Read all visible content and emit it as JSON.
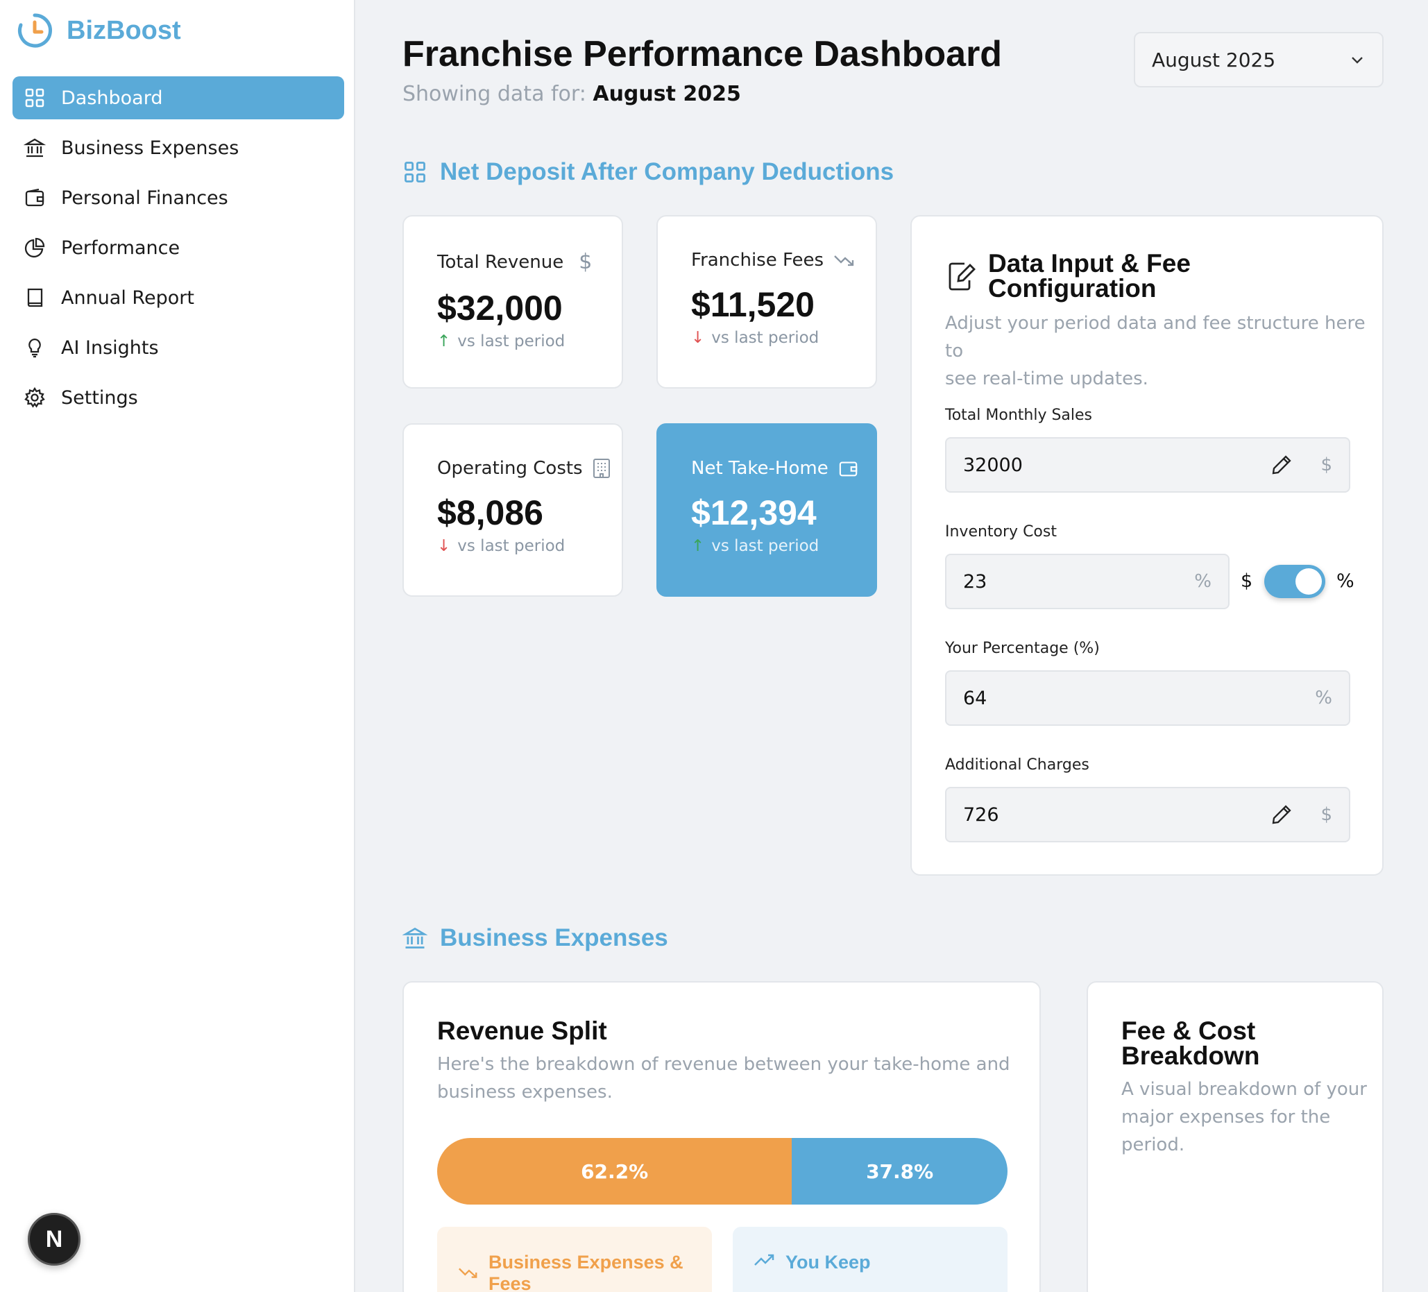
{
  "app": {
    "name": "BizBoost"
  },
  "sidebar": {
    "items": [
      {
        "label": "Dashboard",
        "icon": "grid-icon",
        "active": true
      },
      {
        "label": "Business Expenses",
        "icon": "bank-icon"
      },
      {
        "label": "Personal Finances",
        "icon": "wallet-icon"
      },
      {
        "label": "Performance",
        "icon": "pie-chart-icon"
      },
      {
        "label": "Annual Report",
        "icon": "book-icon"
      },
      {
        "label": "AI Insights",
        "icon": "lightbulb-icon"
      },
      {
        "label": "Settings",
        "icon": "gear-icon"
      }
    ],
    "badge": "N"
  },
  "header": {
    "title": "Franchise Performance Dashboard",
    "subtitle_prefix": "Showing data for: ",
    "subtitle_period": "August 2025",
    "period_select": "August 2025"
  },
  "net_deposit": {
    "heading": "Net Deposit After Company Deductions",
    "cards": [
      {
        "label": "Total Revenue",
        "value": "$32,000",
        "foot": "vs last period",
        "trend": "up",
        "icon": "dollar-icon"
      },
      {
        "label": "Franchise Fees",
        "value": "$11,520",
        "foot": "vs last period",
        "trend": "down",
        "icon": "trending-down-icon"
      },
      {
        "label": "Operating Costs",
        "value": "$8,086",
        "foot": "vs last period",
        "trend": "down",
        "icon": "building-icon"
      },
      {
        "label": "Net Take-Home",
        "value": "$12,394",
        "foot": "vs last period",
        "trend": "up",
        "icon": "wallet-icon"
      }
    ]
  },
  "config": {
    "title_line1": "Data Input & Fee",
    "title_line2": "Configuration",
    "desc_line1": "Adjust your period data and fee structure here to",
    "desc_line2": "see real-time updates.",
    "fields": {
      "sales": {
        "label": "Total Monthly Sales",
        "value": "32000",
        "unit": "$"
      },
      "inventory": {
        "label": "Inventory Cost",
        "value": "23",
        "unit": "%",
        "toggle_left": "$",
        "toggle_right": "%",
        "toggle_on": true
      },
      "percentage": {
        "label": "Your Percentage (%)",
        "value": "64",
        "unit": "%"
      },
      "charges": {
        "label": "Additional Charges",
        "value": "726",
        "unit": "$"
      }
    }
  },
  "business_expenses": {
    "heading": "Business Expenses",
    "revenue_split": {
      "title": "Revenue Split",
      "desc_line1": "Here's the breakdown of revenue between your take-home and",
      "desc_line2": "business expenses.",
      "segments": [
        {
          "label": "62.2%",
          "value": 62.2,
          "color": "#f0a04b"
        },
        {
          "label": "37.8%",
          "value": 37.8,
          "color": "#5aaad8"
        }
      ],
      "box_expenses_line1": "Business Expenses &",
      "box_expenses_line2": "Fees",
      "box_keep": "You Keep"
    },
    "fee_breakdown": {
      "title_line1": "Fee & Cost",
      "title_line2": "Breakdown",
      "desc_line1": "A visual breakdown of your",
      "desc_line2": "major expenses for the",
      "desc_line3": "period."
    }
  },
  "colors": {
    "accent": "#5aaad8",
    "orange": "#f0a04b",
    "up": "#3aa55a",
    "down": "#e05252"
  }
}
